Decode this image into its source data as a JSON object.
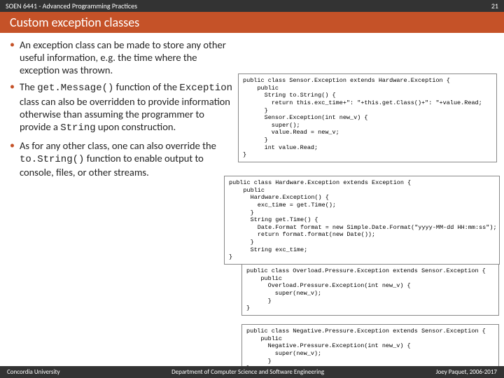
{
  "header": {
    "course": "SOEN 6441 - Advanced Programming Practices",
    "page_number": "21",
    "subtitle": "Custom exception classes"
  },
  "bullets": {
    "b1_pre": "An exception class can be made to store any other useful information, e.g. the time where the exception was thrown.",
    "b2_a": "The ",
    "b2_code1": "get.Message()",
    "b2_b": " function of the ",
    "b2_code2": "Exception",
    "b2_c": " class can also be overridden to provide information otherwise than assuming the programmer to provide a ",
    "b2_code3": "String",
    "b2_d": " upon construction.",
    "b3_a": "As for any other class, one can also override the ",
    "b3_code1": "to.String()",
    "b3_b": " function to enable output to console, files, or other streams."
  },
  "code": {
    "c1": "public class Sensor.Exception extends Hardware.Exception {\n    public\n      String to.String() {\n        return this.exc_time+\": \"+this.get.Class()+\": \"+value.Read;\n      }\n      Sensor.Exception(int new_v) {\n        super();\n        value.Read = new_v;\n      }\n      int value.Read;\n}",
    "c2": "public class Hardware.Exception extends Exception {\n    public\n      Hardware.Exception() {\n        exc_time = get.Time();\n      }\n      String get.Time() {\n        Date.Format format = new Simple.Date.Format(\"yyyy-MM-dd HH:mm:ss\");\n        return format.format(new Date());\n      }\n      String exc_time;\n}",
    "c3": "public class Overload.Pressure.Exception extends Sensor.Exception {\n    public\n      Overload.Pressure.Exception(int new_v) {\n        super(new_v);\n      }\n}",
    "c4": "public class Negative.Pressure.Exception extends Sensor.Exception {\n    public\n      Negative.Pressure.Exception(int new_v) {\n        super(new_v);\n      }\n}"
  },
  "footer": {
    "left": "Concordia University",
    "center": "Department of Computer Science and Software Engineering",
    "right": "Joey Paquet, 2006-2017"
  }
}
